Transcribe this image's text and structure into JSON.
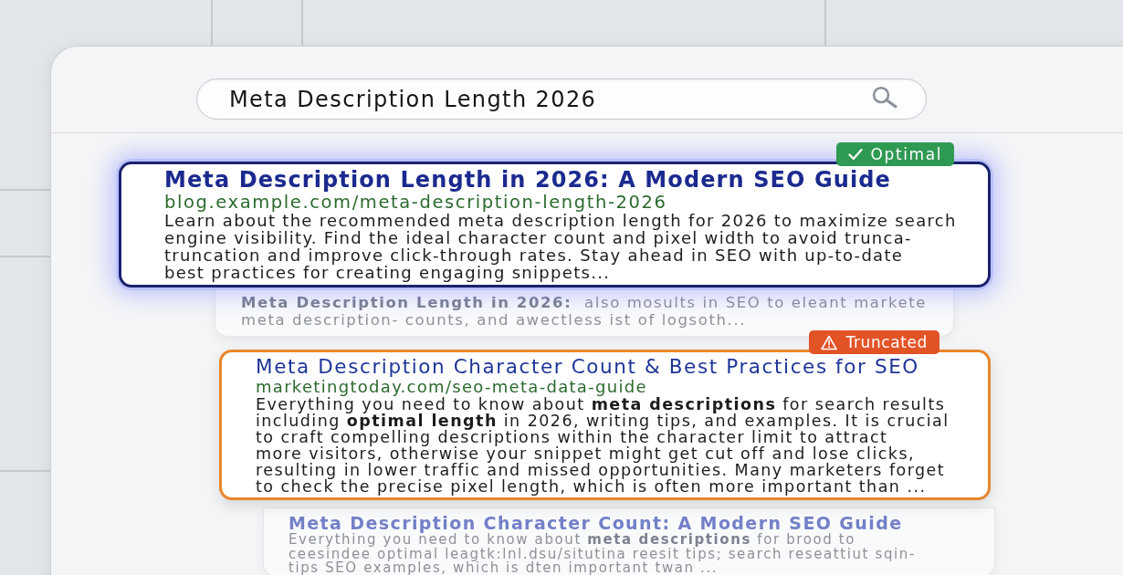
{
  "search": {
    "value": "Meta Description Length 2026"
  },
  "results": [
    {
      "kind": "optimal",
      "badge": "Optimal",
      "title": "Meta Description Length in 2026: A Modern SEO Guide",
      "url": "blog.example.com/meta-description-length-2026",
      "snippet": "Learn about the recommended meta description length for 2026 to maximize search\nengine visibility. Find the ideal character count and pixel width to avoid trunca-\ntruncation and improve click-through rates. Stay ahead in SEO with up-to-date\nbest practices for creating engaging snippets..."
    },
    {
      "kind": "blurred",
      "snippet": "**Meta Description Length in 2026:**  also mosults in SEO to eleant markete\nmeta description- counts, and awectless ist of logsoth..."
    },
    {
      "kind": "truncated",
      "badge": "Truncated",
      "title": "Meta Description Character Count & Best Practices for SEO",
      "url": "marketingtoday.com/seo-meta-data-guide",
      "snippet": "Everything you need to know about **meta descriptions** for search results\nincluding **optimal length** in 2026, writing tips, and examples. It is crucial\nto craft compelling descriptions within the character limit to attract\nmore visitors, otherwise your snippet might get cut off and lose clicks,\nresulting in lower traffic and missed opportunities. Many marketers forget\nto check the precise pixel length, which is often more important than ..."
    },
    {
      "kind": "blurred",
      "title": "Meta Description Character Count: A Modern SEO Guide",
      "snippet": "Everything you need to know about **meta descriptions** for brood to\nceesindee optimal leagtk:lnl.dsu/situtina reesit tips; search reseattiut sqin-\ntips SEO examples, which is dten important twan ..."
    }
  ]
}
